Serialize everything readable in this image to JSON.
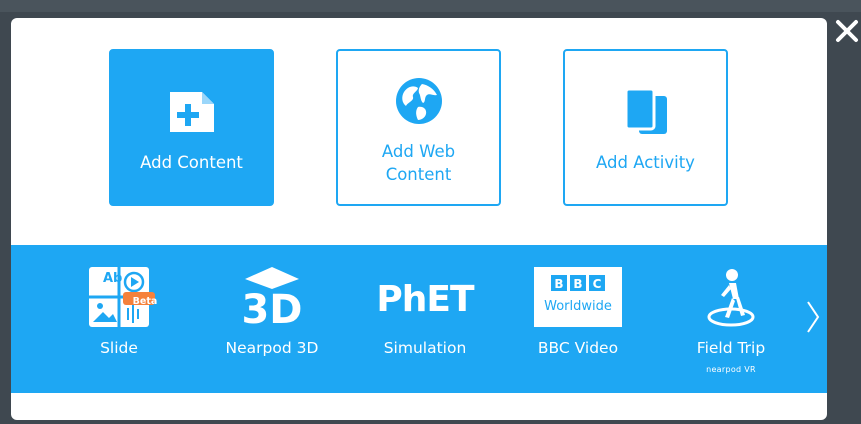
{
  "close": {
    "glyph": "✕"
  },
  "cards": {
    "add_content": "Add Content",
    "add_web_content": "Add Web Content",
    "add_activity": "Add Activity"
  },
  "tiles": {
    "slide": {
      "label": "Slide",
      "badge": "Beta",
      "ab": "Ab"
    },
    "nearpod3d": {
      "label": "Nearpod 3D",
      "logo": "3D"
    },
    "phet": {
      "label": "Simulation",
      "logo": "PhET"
    },
    "bbc": {
      "label": "BBC Video",
      "l1": "B",
      "l2": "B",
      "l3": "C",
      "word": "Worldwide"
    },
    "fieldtrip": {
      "label": "Field Trip",
      "sub": "nearpod VR"
    }
  },
  "colors": {
    "accent": "#1ea7f3",
    "badge": "#f5813b",
    "backdrop": "#3f4850"
  },
  "icons": {
    "close": "close-icon",
    "add_content": "add-file-icon",
    "add_web": "globe-icon",
    "add_activity": "activity-pages-icon",
    "next": "chevron-right-icon"
  }
}
